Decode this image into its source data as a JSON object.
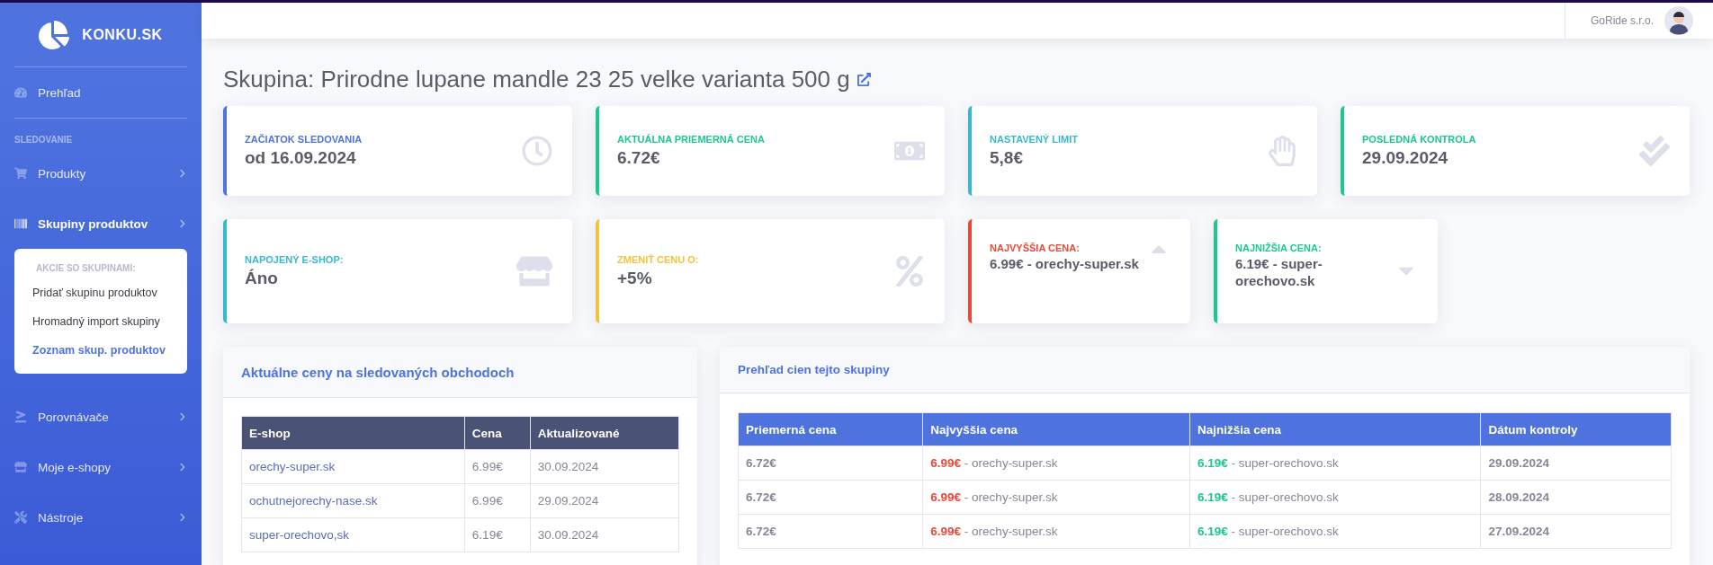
{
  "sidebar": {
    "brand": "KONKU.SK",
    "items": [
      {
        "kind": "link",
        "label": "Prehľad"
      },
      {
        "kind": "heading",
        "label": "SLEDOVANIE"
      },
      {
        "kind": "menu",
        "label": "Produkty",
        "selected": false
      },
      {
        "kind": "menu",
        "label": "Skupiny produktov",
        "selected": true,
        "expanded": true,
        "submenu": {
          "heading": "AKCIE SO SKUPINAMI:",
          "items": [
            {
              "label": "Pridať skupinu produktov",
              "selected": false
            },
            {
              "label": "Hromadný import skupiny",
              "selected": false
            },
            {
              "label": "Zoznam skup. produktov",
              "selected": true
            }
          ]
        }
      },
      {
        "kind": "menu",
        "label": "Porovnávače",
        "selected": false
      },
      {
        "kind": "menu",
        "label": "Moje e-shopy",
        "selected": false
      },
      {
        "kind": "menu",
        "label": "Nástroje",
        "selected": false
      }
    ]
  },
  "topbar": {
    "user": "GoRide s.r.o."
  },
  "page_title": "Skupina: Prirodne lupane mandle 23 25 velke varianta 500 g",
  "stat_cards": [
    {
      "label": "ZAČIATOK SLEDOVANIA",
      "value": "od 16.09.2024",
      "color": "#4e73df"
    },
    {
      "label": "AKTUÁLNA PRIEMERNÁ CENA",
      "value": "6.72€",
      "color": "#1cc88a"
    },
    {
      "label": "NASTAVENÝ LIMIT",
      "value": "5,8€",
      "color": "#36b9cc"
    },
    {
      "label": "POSLEDNÁ KONTROLA",
      "value": "29.09.2024",
      "color": "#1cc88a"
    },
    {
      "label": "NAPOJENÝ E-SHOP:",
      "value": "Áno",
      "color": "#36b9cc"
    },
    {
      "label": "ZMENIŤ CENU O:",
      "value": "+5%",
      "color": "#f6c23e"
    },
    {
      "label": "NAJVYŠŠIA CENA:",
      "value": "6.99€ - orechy-super.sk",
      "color": "#e74a3b"
    },
    {
      "label": "NAJNIŽŠIA CENA:",
      "value": "6.19€ - super-orechovo.sk",
      "color": "#1cc88a"
    }
  ],
  "shops_panel": {
    "title": "Aktuálne ceny na sledovaných obchodoch",
    "columns": [
      "E-shop",
      "Cena",
      "Aktualizované"
    ],
    "rows": [
      {
        "shop": "orechy-super.sk",
        "price": "6.99€",
        "updated": "30.09.2024"
      },
      {
        "shop": "ochutnejorechy-nase.sk",
        "price": "6.99€",
        "updated": "29.09.2024"
      },
      {
        "shop": "super-orechovo,sk",
        "price": "6.19€",
        "updated": "30.09.2024"
      }
    ]
  },
  "overview_panel": {
    "title": "Prehľad cien tejto skupiny",
    "columns": [
      "Priemerná cena",
      "Najvyššia cena",
      "Najnižšia cena",
      "Dátum kontroly"
    ],
    "rows": [
      {
        "average": "6.72€",
        "highest": "**6.99€** - orechy-super.sk",
        "lowest": "**6.19€** - super-orechovo.sk",
        "date": "29.09.2024"
      },
      {
        "average": "6.72€",
        "highest": "**6.99€** - orechy-super.sk",
        "lowest": "**6.19€** - super-orechovo.sk",
        "date": "28.09.2024"
      },
      {
        "average": "6.72€",
        "highest": "**6.99€** - orechy-super.sk",
        "lowest": "**6.19€** - super-orechovo.sk",
        "date": "27.09.2024"
      }
    ]
  }
}
